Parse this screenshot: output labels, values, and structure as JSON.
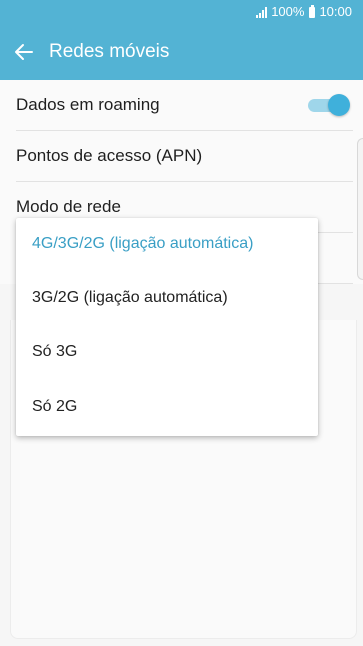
{
  "status_bar": {
    "battery_level": "100%",
    "time": "10:00",
    "signal_icon": "signal-icon",
    "battery_icon": "battery-icon"
  },
  "app_bar": {
    "title": "Redes móveis",
    "back_icon": "arrow-left-icon"
  },
  "settings": {
    "items": [
      {
        "label": "Dados em roaming",
        "toggle_on": true
      },
      {
        "label": "Pontos de acesso (APN)"
      },
      {
        "label": "Modo de rede"
      }
    ]
  },
  "network_mode_menu": {
    "options": [
      {
        "label": "4G/3G/2G (ligação automática)",
        "selected": true
      },
      {
        "label": "3G/2G (ligação automática)",
        "selected": false
      },
      {
        "label": "Só 3G",
        "selected": false
      },
      {
        "label": "Só 2G",
        "selected": false
      }
    ]
  },
  "colors": {
    "accent": "#53b3d4",
    "selected_text": "#3a9fc5",
    "toggle_thumb": "#3fb0db",
    "toggle_track": "#9fd6ea"
  }
}
